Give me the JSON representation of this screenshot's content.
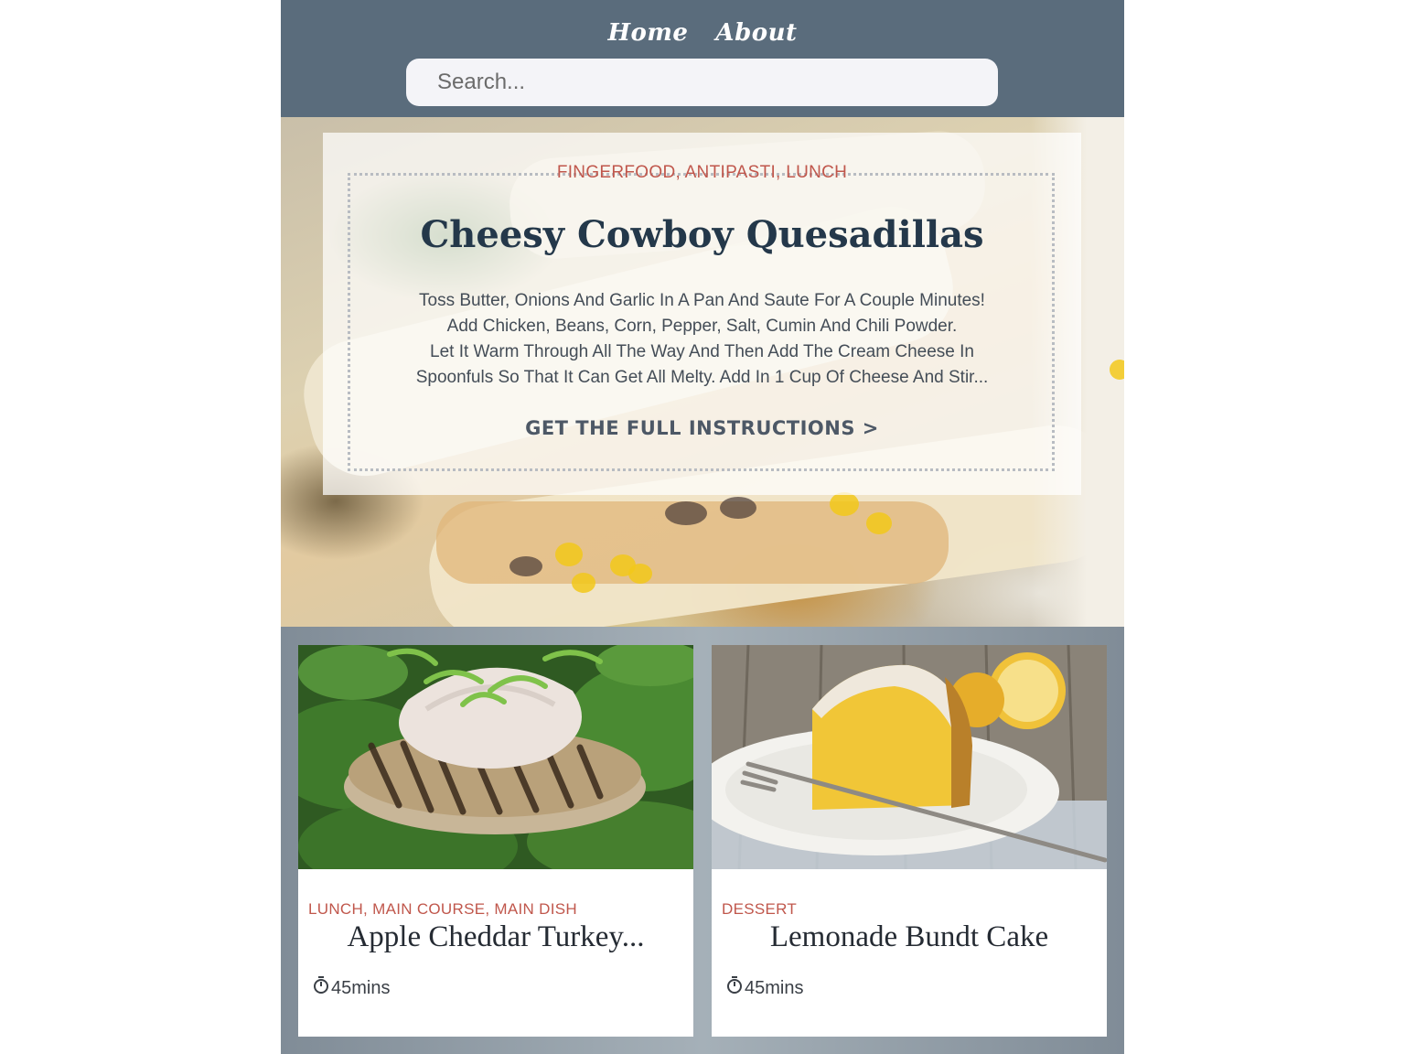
{
  "nav": {
    "items": [
      {
        "label": "Home"
      },
      {
        "label": "About"
      }
    ]
  },
  "search": {
    "placeholder": "Search...",
    "value": ""
  },
  "hero": {
    "categories": "FINGERFOOD, ANTIPASTI, LUNCH",
    "title": "Cheesy Cowboy Quesadillas",
    "description_lines": [
      "Toss Butter, Onions And Garlic In A Pan And Saute For A Couple Minutes!",
      "Add Chicken, Beans, Corn, Pepper, Salt, Cumin And Chili Powder.",
      "Let It Warm Through All The Way And Then Add The Cream Cheese In",
      "Spoonfuls So That It Can Get All Melty. Add In 1 Cup Of Cheese And Stir..."
    ],
    "link_label": "GET THE FULL INSTRUCTIONS >"
  },
  "cards": [
    {
      "categories": "LUNCH, MAIN COURSE, MAIN DISH",
      "title": "Apple Cheddar Turkey...",
      "time": "45mins",
      "time_icon": "stopwatch-icon",
      "image": "turkey-burger-on-spinach"
    },
    {
      "categories": "DESSERT",
      "title": "Lemonade Bundt Cake",
      "time": "45mins",
      "time_icon": "stopwatch-icon",
      "image": "lemon-bundt-cake-slice"
    }
  ],
  "colors": {
    "header_bg": "#5a6c7c",
    "accent_category": "#c0574c",
    "title_dark": "#24384a",
    "cards_bg": "#8a96a1"
  }
}
